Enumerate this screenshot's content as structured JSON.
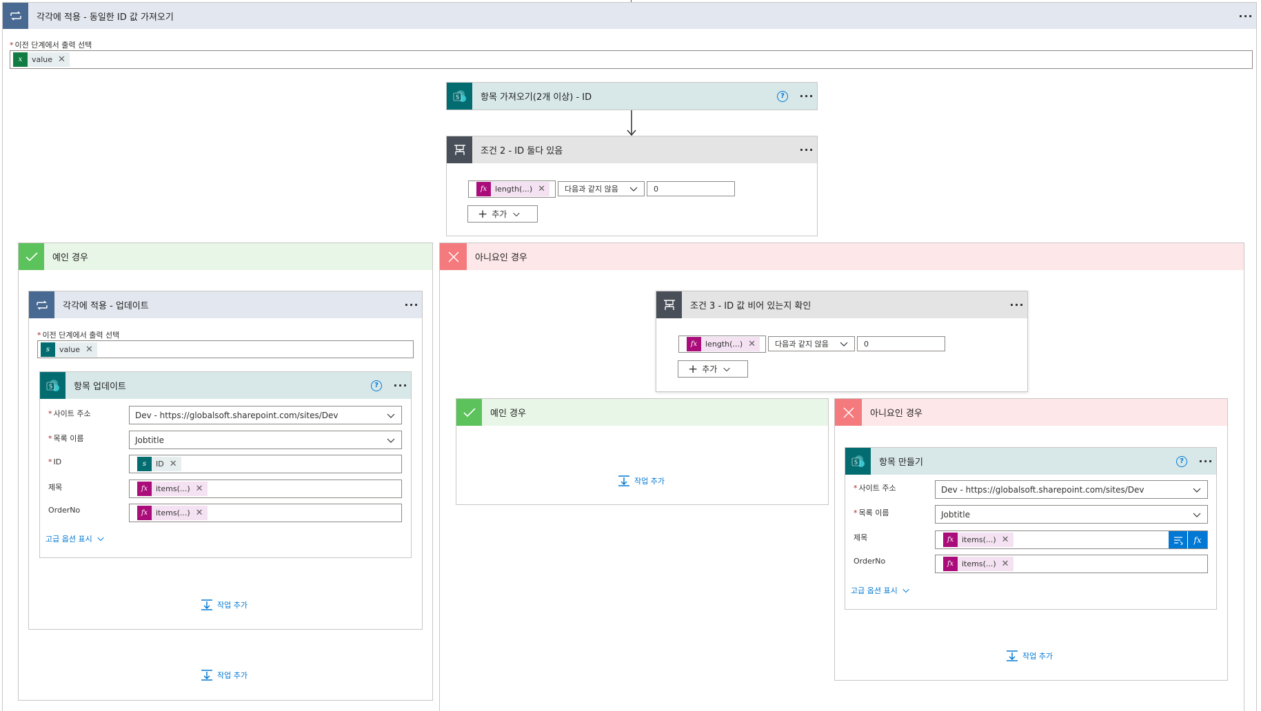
{
  "outer_loop": {
    "title": "각각에 적용 - 동일한 ID 값 가져오기",
    "field_label": "이전 단계에서 출력 선택",
    "token": "value"
  },
  "get_items": {
    "title": "항목 가져오기(2개 이상) - ID"
  },
  "condition2": {
    "title": "조건 2 - ID 둘다 있음",
    "token": "length(...)",
    "operator": "다음과 같지 않음",
    "value": "0",
    "add_label": "추가"
  },
  "yes_branch": {
    "title": "예인 경우",
    "loop": {
      "title": "각각에 적용 - 업데이트",
      "field_label": "이전 단계에서 출력 선택",
      "token": "value"
    },
    "update_item": {
      "title": "항목 업데이트",
      "site_label": "사이트 주소",
      "site_value": "Dev - https://globalsoft.sharepoint.com/sites/Dev",
      "list_label": "목록 이름",
      "list_value": "Jobtitle",
      "id_label": "ID",
      "id_token": "ID",
      "title_label": "제목",
      "title_token": "items(...)",
      "order_label": "OrderNo",
      "order_token": "items(...)",
      "advanced_label": "고급 옵션 표시"
    },
    "inner_add_action": "작업 추가",
    "outer_add_action": "작업 추가"
  },
  "no_branch": {
    "title": "아니요인 경우",
    "condition3": {
      "title": "조건 3 - ID 값 비어 있는지 확인",
      "token": "length(...)",
      "operator": "다음과 같지 않음",
      "value": "0",
      "add_label": "추가"
    },
    "yes_sub": {
      "title": "예인 경우",
      "add_action": "작업 추가"
    },
    "no_sub": {
      "title": "아니요인 경우",
      "create_item": {
        "title": "항목 만들기",
        "site_label": "사이트 주소",
        "site_value": "Dev - https://globalsoft.sharepoint.com/sites/Dev",
        "list_label": "목록 이름",
        "list_value": "Jobtitle",
        "title_label": "제목",
        "title_token": "items(...)",
        "order_label": "OrderNo",
        "order_token": "items(...)",
        "advanced_label": "고급 옵션 표시"
      },
      "add_action": "작업 추가"
    }
  },
  "colors": {
    "loop_header": "#e3e7ef",
    "loop_icon": "#486991",
    "sharepoint_header": "#d8e8e9",
    "sharepoint_icon": "#036c70",
    "condition_header": "#e4e4e4",
    "condition_icon": "#484f58",
    "yes_header": "#e8f6e7",
    "yes_icon": "#5cc25b",
    "no_header": "#fde7e9",
    "no_icon": "#f47a7d",
    "link": "#0078d4"
  }
}
